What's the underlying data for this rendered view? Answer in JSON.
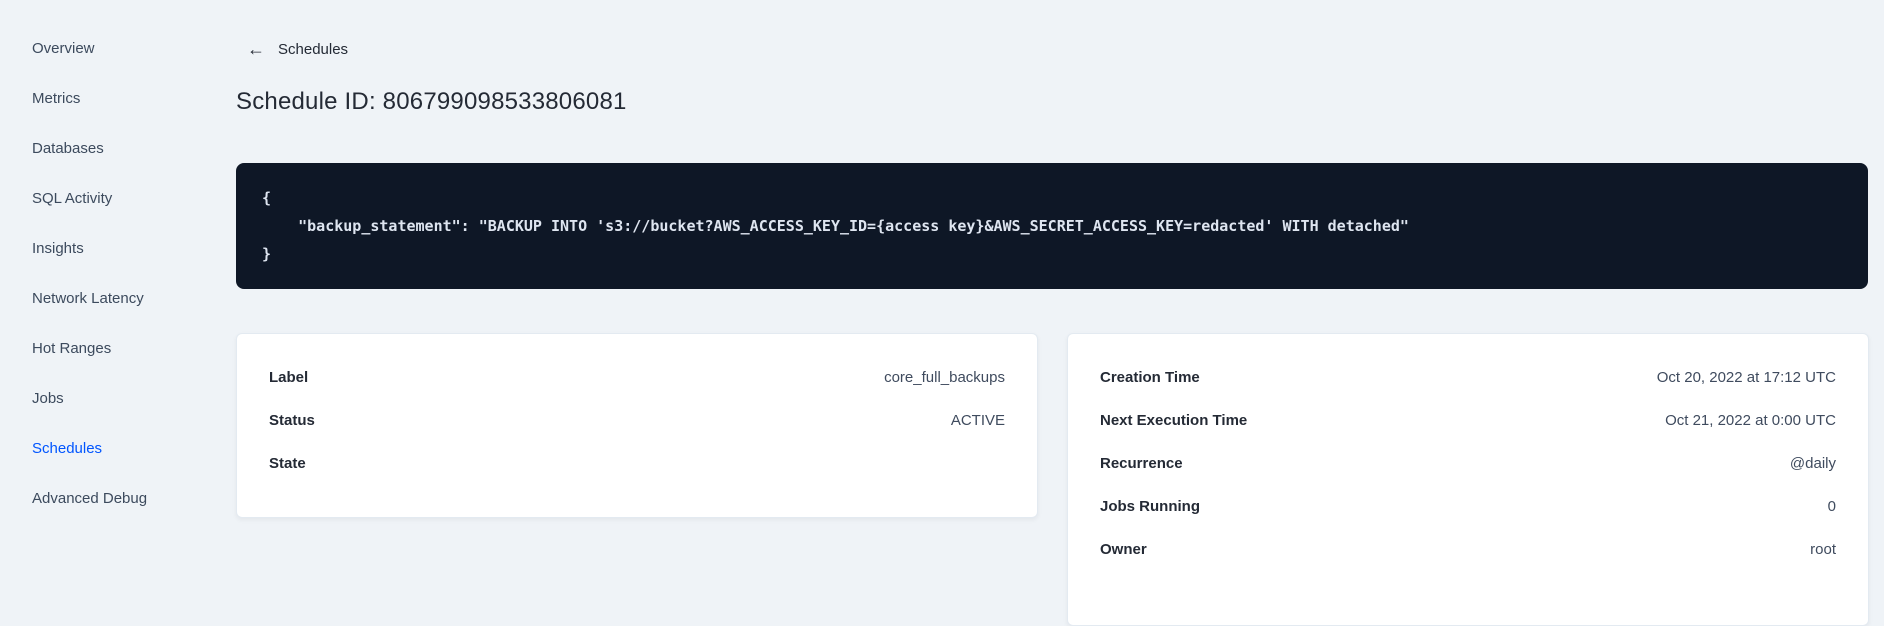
{
  "sidebar": {
    "items": [
      {
        "label": "Overview",
        "active": false
      },
      {
        "label": "Metrics",
        "active": false
      },
      {
        "label": "Databases",
        "active": false
      },
      {
        "label": "SQL Activity",
        "active": false
      },
      {
        "label": "Insights",
        "active": false
      },
      {
        "label": "Network Latency",
        "active": false
      },
      {
        "label": "Hot Ranges",
        "active": false
      },
      {
        "label": "Jobs",
        "active": false
      },
      {
        "label": "Schedules",
        "active": true
      },
      {
        "label": "Advanced Debug",
        "active": false
      }
    ]
  },
  "header": {
    "back_label": "Schedules",
    "back_arrow": "←",
    "title": "Schedule ID: 806799098533806081"
  },
  "code_block": {
    "lines": [
      "{",
      "    \"backup_statement\": \"BACKUP INTO 's3://bucket?AWS_ACCESS_KEY_ID={access key}&AWS_SECRET_ACCESS_KEY=redacted' WITH detached\"",
      "}"
    ]
  },
  "details_left": {
    "rows": [
      {
        "label": "Label",
        "value": "core_full_backups"
      },
      {
        "label": "Status",
        "value": "ACTIVE"
      },
      {
        "label": "State",
        "value": ""
      }
    ]
  },
  "details_right": {
    "rows": [
      {
        "label": "Creation Time",
        "value": "Oct 20, 2022 at 17:12 UTC"
      },
      {
        "label": "Next Execution Time",
        "value": "Oct 21, 2022 at 0:00 UTC"
      },
      {
        "label": "Recurrence",
        "value": "@daily"
      },
      {
        "label": "Jobs Running",
        "value": "0"
      },
      {
        "label": "Owner",
        "value": "root"
      }
    ]
  },
  "colors": {
    "page_background": "#eff3f7",
    "active_nav": "#0055ff",
    "code_background": "#0e1726",
    "code_text": "#dee5f0",
    "card_background": "#ffffff",
    "text_primary": "#242a35",
    "text_secondary": "#3c4a5d"
  }
}
